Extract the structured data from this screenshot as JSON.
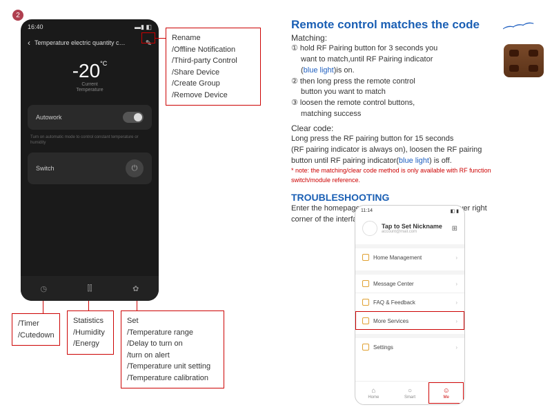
{
  "badge": "2",
  "dark_phone": {
    "time": "16:40",
    "signal": "▬▮ ◧",
    "title": "Temperature electric quantity c…",
    "temp_value": "-20",
    "temp_unit": "°C",
    "temp_label1": "Current",
    "temp_label2": "Temperature",
    "autowork": "Autowork",
    "hint": "Turn on automatic mode to control constant temperature or humidity",
    "switch": "Switch",
    "bottom_icons": {
      "timer": "◷",
      "stats": "⫿⫿",
      "set": "✿"
    }
  },
  "callouts": {
    "pencil": [
      "Rename",
      "/Offline Notification",
      "/Third-party Control",
      "/Share Device",
      "/Create Group",
      "/Remove Device"
    ],
    "timer": [
      "/Timer",
      "/Cutedown"
    ],
    "stats": [
      "Statistics",
      "/Humidity",
      "/Energy"
    ],
    "set": [
      "Set",
      "/Temperature range",
      "/Delay to turn on",
      "/turn on alert",
      "/Temperature unit setting",
      "/Temperature calibration"
    ]
  },
  "right": {
    "title": "Remote control matches the code",
    "matching_h": "Matching:",
    "m1a": "① hold RF Pairing button for 3 seconds you",
    "m1b": "want to match,until RF Pairing indicator",
    "m1c_open": "(",
    "m1c_blue": "blue light",
    "m1c_close": ")is on.",
    "m2a": "② then long press the remote control",
    "m2b": "button you want to match",
    "m3a": "③ loosen the remote control buttons,",
    "m3b": "matching success",
    "clear_h": "Clear code:",
    "c1": "Long press the RF pairing button for 15 seconds",
    "c2": "(RF pairing indicator is always on), loosen the RF pairing",
    "c3a": "button until RF pairing indicator(",
    "c3_blue": "blue light",
    "c3b": ") is off.",
    "note1": "* note: the matching/clear code method is only available with RF function",
    "note2": "switch/module reference.",
    "trouble_h": "TROUBLESHOOTING",
    "t1": "Enter the homepage of App,click the icon in the lower right",
    "t2": "corner of the interface to enter."
  },
  "light_phone": {
    "time": "11:14",
    "sig": "◧ ▮",
    "nick": "Tap to Set Nickname",
    "sub": "account@mail.com",
    "rows": [
      "Home Management",
      "Message Center",
      "FAQ & Feedback",
      "More Services",
      "Settings"
    ],
    "tabs": [
      "Home",
      "Smart",
      "Me"
    ]
  }
}
